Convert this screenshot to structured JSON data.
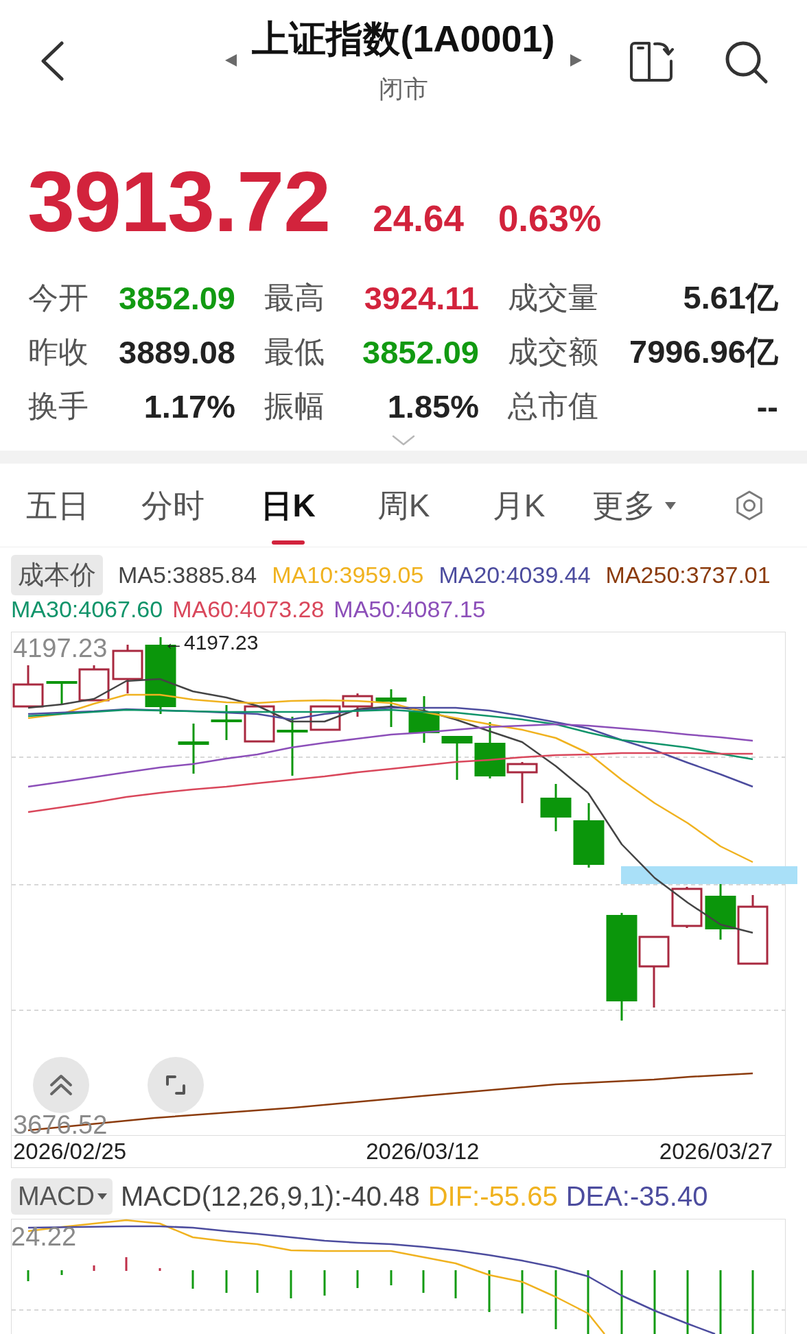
{
  "header": {
    "title": "上证指数(1A0001)",
    "status": "闭市"
  },
  "quote": {
    "price": "3913.72",
    "change": "24.64",
    "change_percent": "0.63%",
    "rising": true
  },
  "stats": [
    {
      "label": "今开",
      "value": "3852.09",
      "color": "#129a12"
    },
    {
      "label": "最高",
      "value": "3924.11",
      "color": "#d2233c"
    },
    {
      "label": "成交量",
      "value": "5.61亿",
      "color": "#222222"
    },
    {
      "label": "昨收",
      "value": "3889.08",
      "color": "#222222"
    },
    {
      "label": "最低",
      "value": "3852.09",
      "color": "#129a12"
    },
    {
      "label": "成交额",
      "value": "7996.96亿",
      "color": "#222222"
    },
    {
      "label": "换手",
      "value": "1.17%",
      "color": "#222222"
    },
    {
      "label": "振幅",
      "value": "1.85%",
      "color": "#222222"
    },
    {
      "label": "总市值",
      "value": "--",
      "color": "#222222"
    }
  ],
  "tabs": [
    {
      "label": "五日",
      "kind": "tab",
      "selected": false
    },
    {
      "label": "分时",
      "kind": "tab",
      "selected": false
    },
    {
      "label": "日K",
      "kind": "tab",
      "selected": true
    },
    {
      "label": "周K",
      "kind": "tab",
      "selected": false
    },
    {
      "label": "月K",
      "kind": "tab",
      "selected": false
    },
    {
      "label": "更多",
      "kind": "menu",
      "selected": false
    }
  ],
  "kline": {
    "indicator": "成本价",
    "moving_averages": [
      {
        "label": "MA5:3885.84",
        "color": "#444444"
      },
      {
        "label": "MA10:3959.05",
        "color": "#f0b21f"
      },
      {
        "label": "MA20:4039.44",
        "color": "#4c4c9e"
      },
      {
        "label": "MA250:3737.01",
        "color": "#8b3b0c"
      },
      {
        "label": "MA30:4067.60",
        "color": "#10946a"
      },
      {
        "label": "MA60:4073.28",
        "color": "#d9475b"
      },
      {
        "label": "MA50:4087.15",
        "color": "#8c4fb9"
      }
    ],
    "axis_max": "4197.23",
    "axis_min": "3676.52",
    "peak_label": "←4197.23",
    "dates": [
      "2026/02/25",
      "2026/03/12",
      "2026/03/27"
    ]
  },
  "macd": {
    "indicator": "MACD",
    "readings": [
      {
        "label": "MACD(12,26,9,1):-40.48",
        "color": "#444444"
      },
      {
        "label": "DIF:-55.65",
        "color": "#f0b21f"
      },
      {
        "label": "DEA:-35.40",
        "color": "#4c4c9e"
      }
    ],
    "axis_max": "24.22"
  }
}
